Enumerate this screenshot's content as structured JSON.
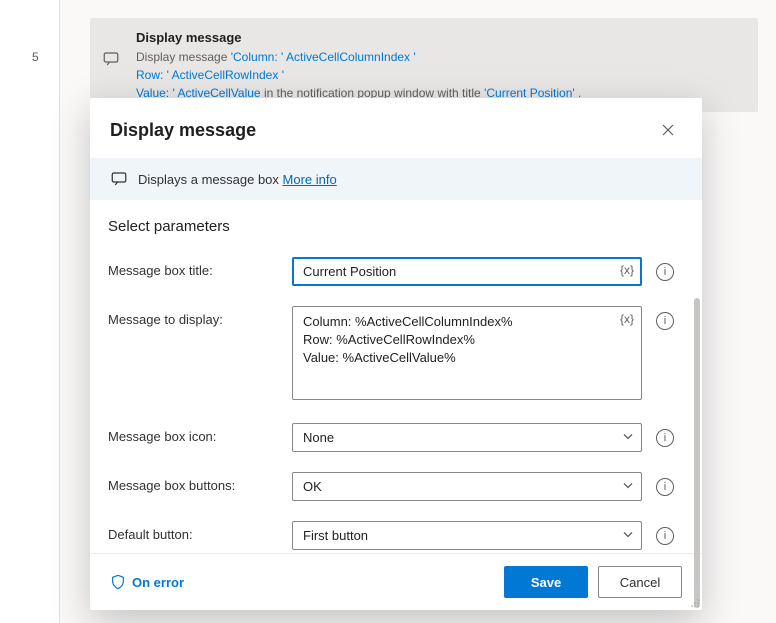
{
  "background": {
    "step_number": "5",
    "card_title": "Display message",
    "card_body_prefix": "Display message ",
    "body_parts": {
      "p1": "'Column: '",
      "v1": "ActiveCellColumnIndex",
      "p2": "'\nRow: '",
      "v2": "ActiveCellRowIndex",
      "p3": "'\nValue: '",
      "v3": "ActiveCellValue",
      "suffix": " in the notification popup window with title ",
      "title_literal": "'Current Position'",
      "end": "."
    }
  },
  "modal": {
    "title": "Display message",
    "banner_text": "Displays a message box ",
    "more_info": "More info",
    "section_title": "Select parameters",
    "params": {
      "title": {
        "label": "Message box title:",
        "value": "Current Position"
      },
      "message": {
        "label": "Message to display:",
        "value": "Column: %ActiveCellColumnIndex%\nRow: %ActiveCellRowIndex%\nValue: %ActiveCellValue%"
      },
      "icon": {
        "label": "Message box icon:",
        "value": "None"
      },
      "buttons": {
        "label": "Message box buttons:",
        "value": "OK"
      },
      "default_button": {
        "label": "Default button:",
        "value": "First button"
      }
    },
    "var_token": "{x}",
    "on_error": "On error",
    "save": "Save",
    "cancel": "Cancel"
  }
}
